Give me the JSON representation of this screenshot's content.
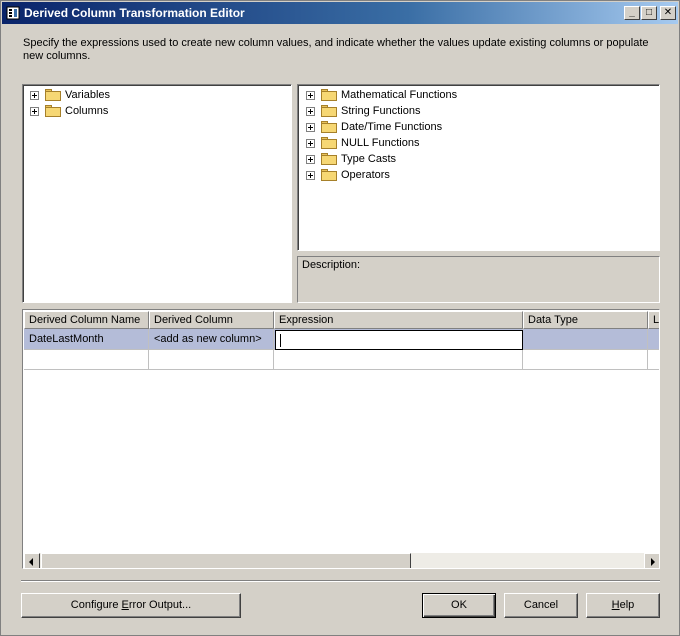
{
  "window": {
    "title": "Derived Column Transformation Editor",
    "minimize_glyph": "_",
    "maximize_glyph": "□",
    "close_glyph": "✕"
  },
  "instruction": "Specify the expressions used to create new column values, and indicate whether the values update existing columns or populate new columns.",
  "left_tree": [
    {
      "label": "Variables"
    },
    {
      "label": "Columns"
    }
  ],
  "right_tree": [
    {
      "label": "Mathematical Functions"
    },
    {
      "label": "String Functions"
    },
    {
      "label": "Date/Time Functions"
    },
    {
      "label": "NULL Functions"
    },
    {
      "label": "Type Casts"
    },
    {
      "label": "Operators"
    }
  ],
  "description_label": "Description:",
  "grid": {
    "headers": [
      "Derived Column Name",
      "Derived Column",
      "Expression",
      "Data Type",
      "Le"
    ],
    "rows": [
      {
        "name": "DateLastMonth",
        "derived_column": "<add as new column>",
        "expression": "",
        "data_type": ""
      }
    ]
  },
  "buttons": {
    "configure_error_pre": "Configure ",
    "configure_error_u": "E",
    "configure_error_post": "rror Output...",
    "ok": "OK",
    "cancel": "Cancel",
    "help_u": "H",
    "help_post": "elp"
  },
  "colors": {
    "titlebar_start": "#0a246a",
    "selected_row": "#b4bcd8",
    "dialog_face": "#d4d0c8"
  }
}
